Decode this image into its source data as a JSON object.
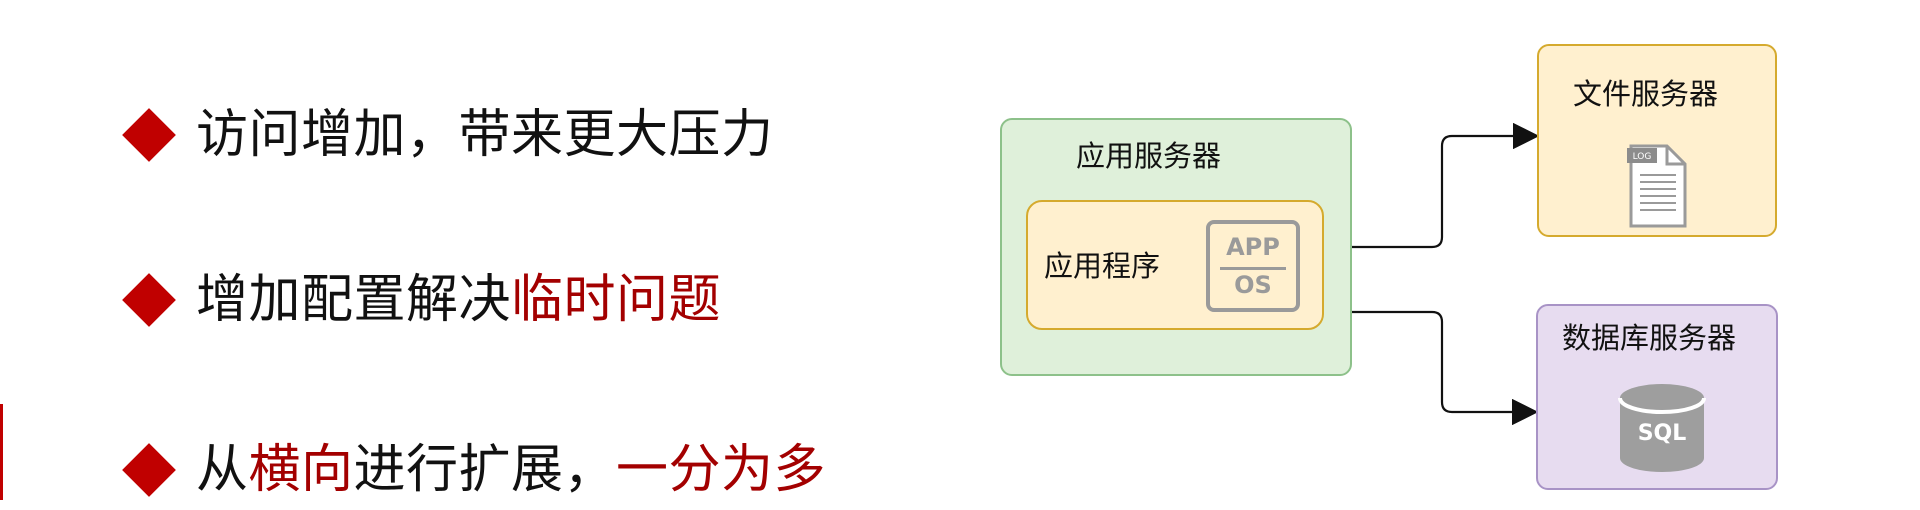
{
  "bullets": [
    {
      "segments": [
        {
          "text": "访问增加，带来更大压力",
          "highlight": false
        }
      ]
    },
    {
      "segments": [
        {
          "text": "增加配置解决",
          "highlight": false
        },
        {
          "text": "临时问题",
          "highlight": true
        }
      ]
    },
    {
      "segments": [
        {
          "text": "从",
          "highlight": false
        },
        {
          "text": "横向",
          "highlight": true
        },
        {
          "text": "进行扩展，",
          "highlight": false
        },
        {
          "text": "一分为多",
          "highlight": true
        }
      ]
    }
  ],
  "diagram": {
    "app_server": {
      "title": "应用服务器",
      "program_title": "应用程序",
      "icon_top": "APP",
      "icon_bottom": "OS",
      "icon_name": "app-os-icon"
    },
    "file_server": {
      "title": "文件服务器",
      "icon_label": "LOG",
      "icon_name": "log-file-icon"
    },
    "db_server": {
      "title": "数据库服务器",
      "icon_label": "SQL",
      "icon_name": "sql-database-icon"
    }
  },
  "colors": {
    "accent_red": "#c00000",
    "highlight_text": "#a30000",
    "app_server_fill": "#dff0da",
    "app_server_border": "#8dc18a",
    "app_program_fill": "#fff0cf",
    "app_program_border": "#d5aa2e",
    "db_server_fill": "#e7dcf0",
    "db_server_border": "#a893c6"
  }
}
